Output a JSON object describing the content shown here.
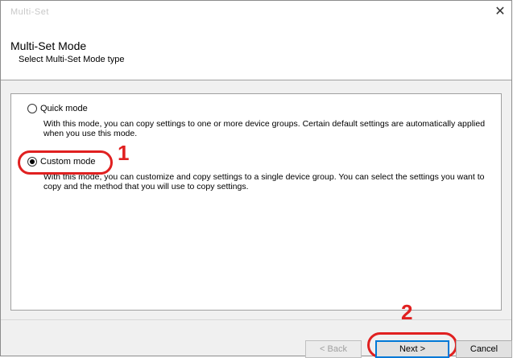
{
  "window": {
    "title": "Multi-Set",
    "close_glyph": "✕"
  },
  "header": {
    "title": "Multi-Set Mode",
    "subtitle": "Select Multi-Set Mode type"
  },
  "options": [
    {
      "label": "Quick mode",
      "selected": false,
      "description": "With this mode, you can copy settings to one or more device groups. Certain default settings are automatically applied when you use this mode."
    },
    {
      "label": "Custom mode",
      "selected": true,
      "description": "With this mode, you can customize and copy settings to a single device group. You can select the settings you want to copy and the method that you will use to copy settings."
    }
  ],
  "callouts": {
    "step1": "1",
    "step2": "2",
    "color": "#e02020"
  },
  "buttons": {
    "back": "< Back",
    "next": "Next >",
    "cancel": "Cancel"
  },
  "colors": {
    "accent": "#0078d7",
    "panel_bg": "#f0f0f0"
  }
}
